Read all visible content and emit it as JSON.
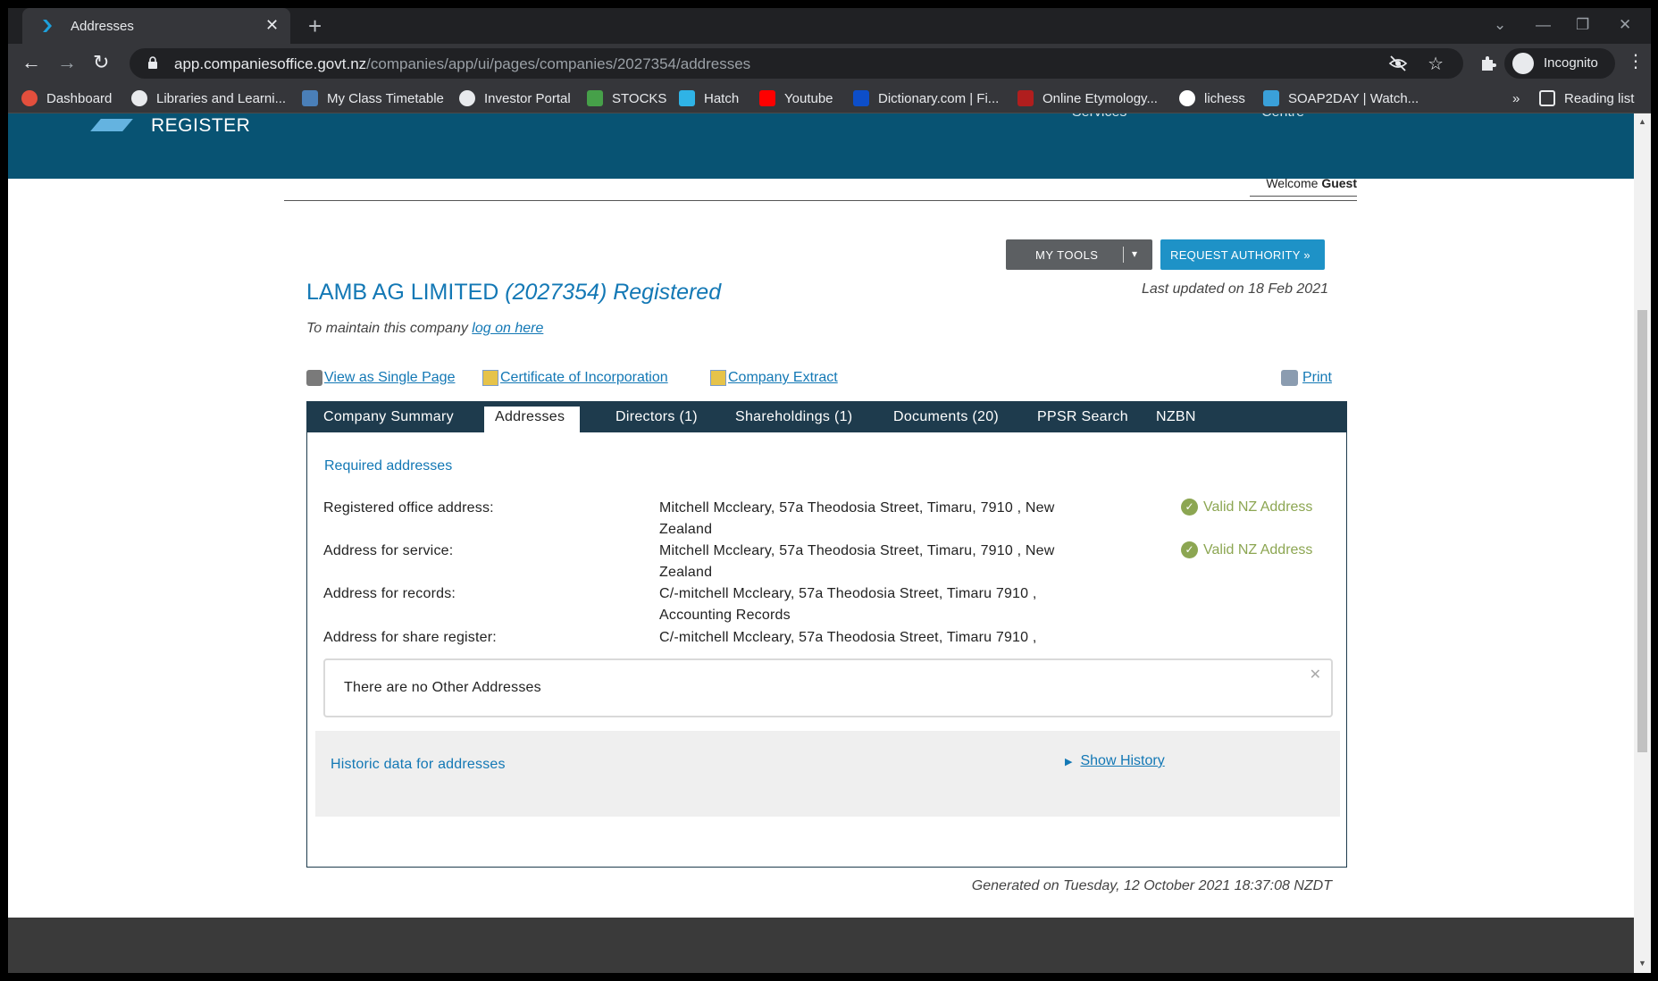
{
  "browser": {
    "tab_title": "Addresses",
    "tab_close": "✕",
    "new_tab": "+",
    "window_controls": {
      "collapse": "⌄",
      "minimize": "—",
      "restore": "❐",
      "close": "✕"
    },
    "nav": {
      "back": "←",
      "forward": "→",
      "reload": "↻"
    },
    "url_host": "app.companiesoffice.govt.nz",
    "url_path": "/companies/app/ui/pages/companies/2027354/addresses",
    "star": "☆",
    "incognito_label": "Incognito",
    "menu": "⋮",
    "bookmarks": [
      {
        "label": "Dashboard",
        "icon": "dashboard-icon",
        "color": "#e34f3d"
      },
      {
        "label": "Libraries and Learni...",
        "icon": "globe-icon",
        "color": "#e8eaed"
      },
      {
        "label": "My Class Timetable",
        "icon": "timetable-icon",
        "color": "#4a7fb8"
      },
      {
        "label": "Investor Portal",
        "icon": "globe-icon",
        "color": "#e8eaed"
      },
      {
        "label": "STOCKS",
        "icon": "chart-icon",
        "color": "#46a049"
      },
      {
        "label": "Hatch",
        "icon": "hatch-icon",
        "color": "#2fb3e6"
      },
      {
        "label": "Youtube",
        "icon": "youtube-icon",
        "color": "#ff0000"
      },
      {
        "label": "Dictionary.com | Fi...",
        "icon": "dictionary-icon",
        "color": "#0d4ec9"
      },
      {
        "label": "Online Etymology...",
        "icon": "etymology-icon",
        "color": "#b01e1e"
      },
      {
        "label": "lichess",
        "icon": "lichess-icon",
        "color": "#ffffff"
      },
      {
        "label": "SOAP2DAY | Watch...",
        "icon": "soap2day-icon",
        "color": "#3aa0d9"
      }
    ],
    "bookmarks_overflow": "»",
    "reading_list": "Reading list"
  },
  "site": {
    "banner_word": "REGISTER",
    "banner_ghost_1": "Services",
    "banner_ghost_2": "Centre",
    "welcome_text": "Welcome",
    "welcome_user": "Guest",
    "my_tools": "MY TOOLS",
    "my_tools_caret": "▾",
    "request_authority": "REQUEST AUTHORITY »",
    "company_name": "LAMB AG LIMITED",
    "company_number_status": "(2027354) Registered",
    "last_updated": "Last updated on 18 Feb 2021",
    "maintain_prefix": "To maintain this company",
    "maintain_link": "log on here",
    "links": {
      "single_page": "View as Single Page",
      "certificate": "Certificate of Incorporation",
      "extract": "Company Extract",
      "print": "Print"
    },
    "tabs": [
      "Company Summary",
      "Addresses",
      "Directors (1)",
      "Shareholdings (1)",
      "Documents (20)",
      "PPSR Search",
      "NZBN"
    ],
    "active_tab": "Addresses",
    "required_heading": "Required addresses",
    "addresses": [
      {
        "label": "Registered office address:",
        "value": "Mitchell Mccleary, 57a Theodosia Street, Timaru, 7910 , New Zealand",
        "status": "Valid NZ Address"
      },
      {
        "label": "Address for service:",
        "value": "Mitchell Mccleary, 57a Theodosia Street, Timaru, 7910 , New Zealand",
        "status": "Valid NZ Address"
      },
      {
        "label": "Address for records:",
        "value": "C/-mitchell Mccleary, 57a Theodosia Street, Timaru 7910 , Accounting Records",
        "status": ""
      },
      {
        "label": "Address for share register:",
        "value": "C/-mitchell Mccleary, 57a Theodosia Street, Timaru 7910 ,",
        "status": ""
      }
    ],
    "valid_check": "✓",
    "other_addresses": "There are no Other Addresses",
    "other_close": "✕",
    "historic_heading": "Historic data for addresses",
    "show_history": "Show History",
    "show_history_triangle": "▶",
    "generated": "Generated on Tuesday, 12 October 2021 18:37:08 NZDT"
  },
  "colors": {
    "banner": "#085373",
    "link": "#1378b5",
    "tabs_bar": "#1e3b4d",
    "valid_green": "#8ca652",
    "request_button": "#1e92c7"
  }
}
